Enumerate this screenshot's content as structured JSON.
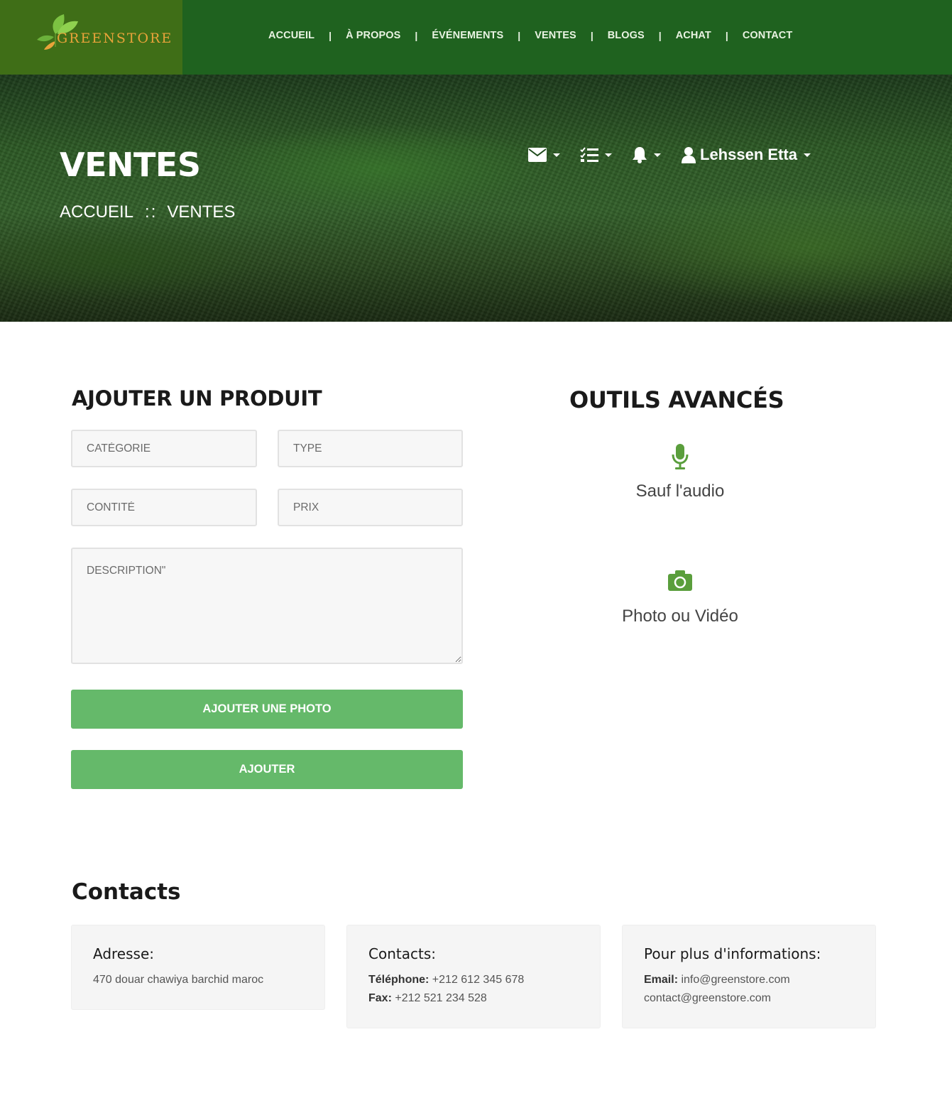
{
  "brand": {
    "logo_text": "GREENSTORE"
  },
  "nav": [
    {
      "label": "ACCUEIL"
    },
    {
      "label": "À PROPOS"
    },
    {
      "label": "ÉVÉNEMENTS"
    },
    {
      "label": "VENTES"
    },
    {
      "label": "BLOGS"
    },
    {
      "label": "ACHAT"
    },
    {
      "label": "CONTACT"
    }
  ],
  "nav_separator": "|",
  "hero": {
    "title": "VENTES",
    "breadcrumb": {
      "home": "ACCUEIL",
      "separator": "::",
      "current": "VENTES"
    },
    "toolbar": {
      "icons": [
        "envelope-icon",
        "tasks-icon",
        "bell-icon",
        "user-icon"
      ],
      "user_name": "Lehssen Etta"
    }
  },
  "form": {
    "title": "AJOUTER UN PRODUIT",
    "category_placeholder": "CATÉGORIE",
    "type_placeholder": "TYPE",
    "quantity_placeholder": "CONTITÉ",
    "price_placeholder": "PRIX",
    "description_placeholder": "DESCRIPTION\"",
    "add_photo_label": "AJOUTER UNE PHOTO",
    "submit_label": "AJOUTER"
  },
  "tools": {
    "title": "OUTILS AVANCÉS",
    "audio": {
      "icon": "microphone-icon",
      "label": "Sauf l'audio"
    },
    "media": {
      "icon": "camera-icon",
      "label": "Photo ou Vidéo"
    }
  },
  "contacts": {
    "title": "Contacts",
    "address": {
      "title": "Adresse:",
      "text": "470 douar chawiya barchid maroc"
    },
    "phones": {
      "title": "Contacts:",
      "phone_label": "Téléphone:",
      "phone": "+212 612 345 678",
      "fax_label": "Fax:",
      "fax": "+212 521 234 528"
    },
    "info": {
      "title": "Pour plus d'informations:",
      "email_label": "Email:",
      "email": "info@greenstore.com",
      "email2": "contact@greenstore.com"
    }
  },
  "colors": {
    "header": "#1f621f",
    "logo_bg": "#3f6e17",
    "button": "#65b96a",
    "icon_green": "#5a9e3c"
  }
}
